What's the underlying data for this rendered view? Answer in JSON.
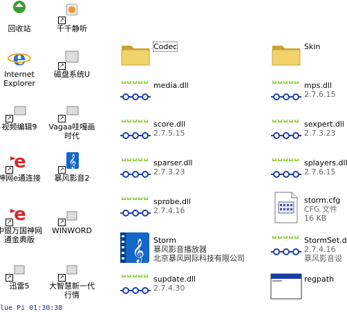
{
  "desktop": {
    "items": [
      {
        "label": "回收站",
        "icon": "recycle-bin-icon"
      },
      {
        "label": "千千静听",
        "icon": "ttplayer-icon"
      },
      {
        "label": "Internet Explorer",
        "icon": "ie-icon"
      },
      {
        "label": "磁盘系统U",
        "icon": "disk-system-icon"
      },
      {
        "label": "视频编辑9",
        "icon": "video-editor-icon"
      },
      {
        "label": "Vagaa哇嘎画时代",
        "icon": "vagaa-icon"
      },
      {
        "label": "神网e通连接",
        "icon": "e-connect-icon"
      },
      {
        "label": "暴风影音2",
        "icon": "storm-player-icon"
      },
      {
        "label": "中银万国神网通金典版",
        "icon": "e-connect-icon"
      },
      {
        "label": "WINWORD",
        "icon": "word-icon"
      },
      {
        "label": "迅雷5",
        "icon": "thunder-icon"
      },
      {
        "label": "大智慧新一代行情",
        "icon": "dzh-icon"
      }
    ]
  },
  "status_text": "lue Pi 01:30:38",
  "files": [
    {
      "name": "Codec",
      "sub": "",
      "sub2": "",
      "icon": "folder-icon",
      "selected": true
    },
    {
      "name": "Skin",
      "sub": "",
      "sub2": "",
      "icon": "folder-icon"
    },
    {
      "name": "media.dll",
      "sub": "",
      "sub2": "",
      "icon": "dll-icon"
    },
    {
      "name": "mps.dll",
      "sub": "2.7.6.15",
      "sub2": "",
      "icon": "dll-icon"
    },
    {
      "name": "score.dll",
      "sub": "2.7.5.15",
      "sub2": "",
      "icon": "dll-icon"
    },
    {
      "name": "sexpert.dll",
      "sub": "2.7.3.23",
      "sub2": "",
      "icon": "dll-icon"
    },
    {
      "name": "sparser.dll",
      "sub": "2.7.3.23",
      "sub2": "",
      "icon": "dll-icon"
    },
    {
      "name": "splayers.dll",
      "sub": "2.7.6.15",
      "sub2": "",
      "icon": "dll-icon"
    },
    {
      "name": "sprobe.dll",
      "sub": "2.7.4.16",
      "sub2": "",
      "icon": "dll-icon"
    },
    {
      "name": "storm.cfg",
      "sub": "CFG 文件",
      "sub2": "16 KB",
      "icon": "config-file-icon"
    },
    {
      "name": "Storm",
      "sub": "暴风影音播放器",
      "sub2": "北京暴风网际科技有限公司",
      "icon": "storm-app-icon"
    },
    {
      "name": "StormSet.dll",
      "sub": "2.7.4.16",
      "sub2": "暴风影音设",
      "icon": "dll-icon"
    },
    {
      "name": "supdate.dll",
      "sub": "2.7.4.30",
      "sub2": "",
      "icon": "dll-icon"
    },
    {
      "name": "regpath",
      "sub": "",
      "sub2": "",
      "icon": "window-app-icon"
    }
  ],
  "colors": {
    "folder": "#f2d36b",
    "folder_dark": "#c9a233",
    "dll_green": "#8fcf3c",
    "dll_blue": "#1f3fa8",
    "storm_blue": "#1466c8"
  }
}
